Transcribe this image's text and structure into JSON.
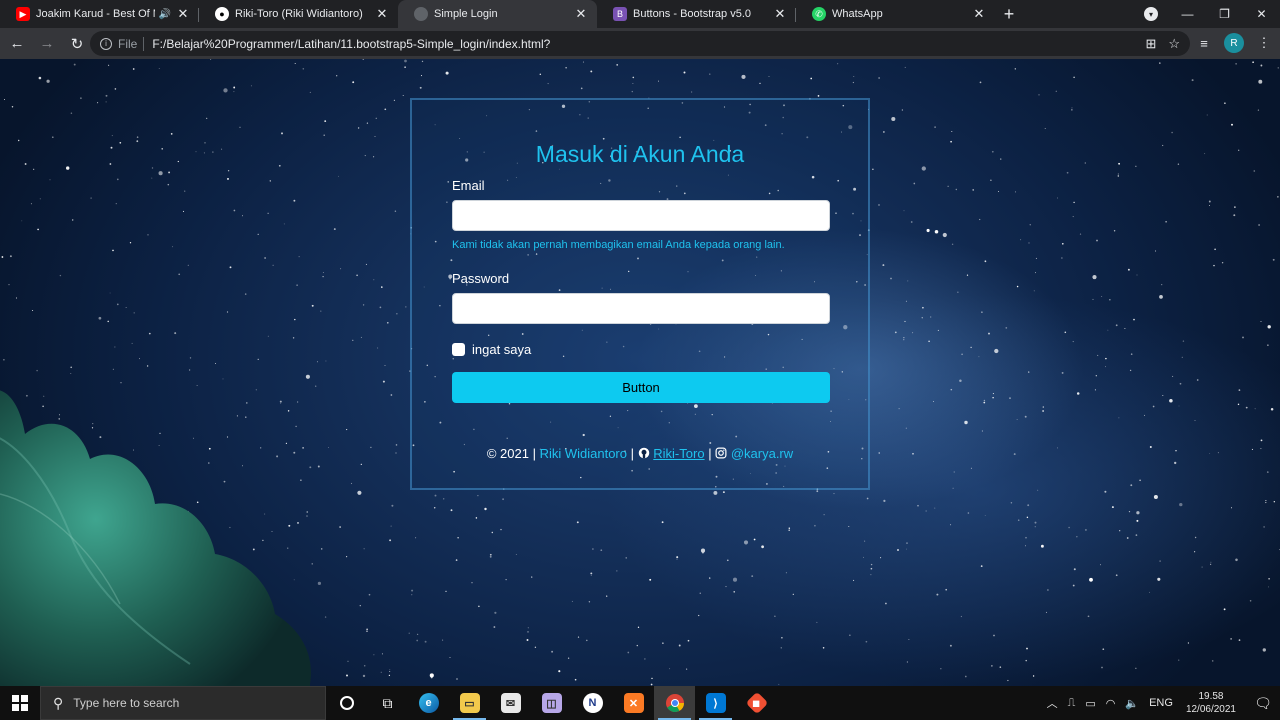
{
  "browser": {
    "tabs": [
      {
        "title": "Joakim Karud - Best Of Mix -",
        "favicon": "youtube-icon",
        "color": "#ff0000",
        "audio": true,
        "active": false
      },
      {
        "title": "Riki-Toro (Riki Widiantoro)",
        "favicon": "github-icon",
        "color": "#ffffff",
        "audio": false,
        "active": false
      },
      {
        "title": "Simple Login",
        "favicon": "globe-icon",
        "color": "#9aa0a6",
        "audio": false,
        "active": true
      },
      {
        "title": "Buttons - Bootstrap v5.0",
        "favicon": "bootstrap-icon",
        "color": "#7952b3",
        "audio": false,
        "active": false
      },
      {
        "title": "WhatsApp",
        "favicon": "whatsapp-icon",
        "color": "#25d366",
        "audio": false,
        "active": false
      }
    ],
    "omnibox": {
      "scheme_label": "File",
      "url": "F:/Belajar%20Programmer/Latihan/11.bootstrap5-Simple_login/index.html?"
    },
    "profile_initial": "R"
  },
  "login": {
    "title": "Masuk di Akun Anda",
    "email_label": "Email",
    "email_value": "",
    "email_help": "Kami tidak akan pernah membagikan email Anda kepada orang lain.",
    "password_label": "Password",
    "password_value": "",
    "remember_label": "ingat saya",
    "remember_checked": false,
    "submit_label": "Button",
    "accent_color": "#1fc2ee",
    "button_color": "#0dcaf0"
  },
  "footer": {
    "copyright": "© 2021 |",
    "author_link": "Riki Widiantoro",
    "sep1": "|",
    "github_link": "Riki-Toro",
    "sep2": "|",
    "instagram_link": "@karya.rw"
  },
  "taskbar": {
    "search_placeholder": "Type here to search",
    "apps": [
      "cortana-icon",
      "task-view-icon",
      "edge-icon",
      "file-explorer-icon",
      "mail-icon",
      "photos-icon",
      "app-icon",
      "xampp-icon",
      "chrome-icon",
      "vscode-icon",
      "git-icon"
    ],
    "language": "ENG",
    "time": "19.58",
    "date": "12/06/2021"
  }
}
